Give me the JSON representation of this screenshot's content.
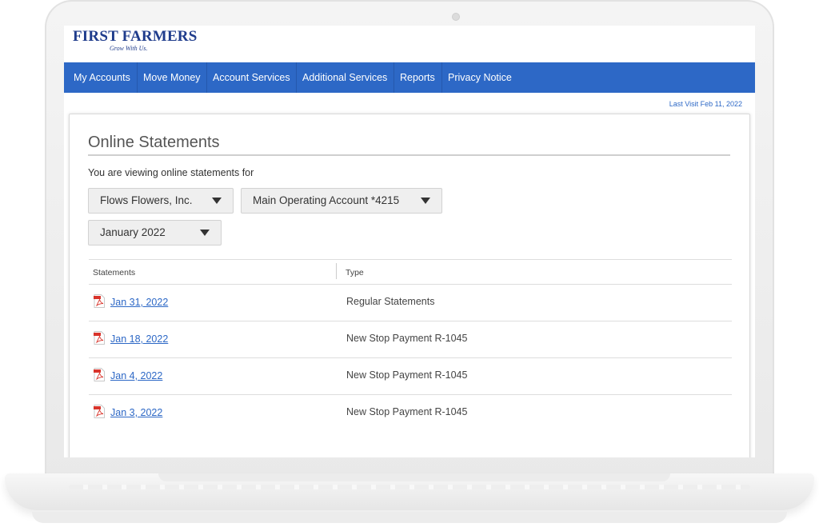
{
  "brand": {
    "name": "FIRST FARMERS",
    "tagline": "Grow With Us."
  },
  "nav": {
    "items": [
      {
        "label": "My Accounts"
      },
      {
        "label": "Move Money"
      },
      {
        "label": "Account Services"
      },
      {
        "label": "Additional Services"
      },
      {
        "label": "Reports"
      },
      {
        "label": "Privacy Notice"
      }
    ]
  },
  "last_visit": "Last Visit Feb 11, 2022",
  "page": {
    "title": "Online Statements",
    "viewing_label": "You are viewing online statements for"
  },
  "filters": {
    "company": "Flows Flowers, Inc.",
    "account": "Main Operating Account *4215",
    "period": "January 2022"
  },
  "table": {
    "headers": [
      "Statements",
      "Type"
    ],
    "rows": [
      {
        "date": "Jan 31, 2022",
        "type": "Regular Statements"
      },
      {
        "date": "Jan 18, 2022",
        "type": "New Stop Payment R-1045"
      },
      {
        "date": "Jan 4, 2022",
        "type": "New Stop Payment R-1045"
      },
      {
        "date": "Jan 3, 2022",
        "type": "New Stop Payment R-1045"
      }
    ]
  },
  "colors": {
    "brand_blue": "#1f3c8c",
    "nav_blue": "#2d68c6",
    "link_blue": "#2d68c6",
    "pdf_red": "#d9342b"
  }
}
